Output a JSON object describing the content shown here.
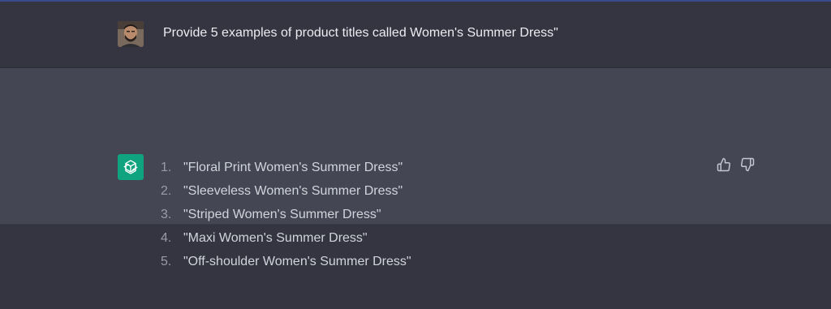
{
  "conversation": {
    "user_message": "Provide 5 examples of product titles called Women's Summer Dress\"",
    "assistant_items": [
      {
        "num": "1.",
        "text": "\"Floral Print Women's Summer Dress\""
      },
      {
        "num": "2.",
        "text": "\"Sleeveless Women's Summer Dress\""
      },
      {
        "num": "3.",
        "text": "\"Striped Women's Summer Dress\""
      },
      {
        "num": "4.",
        "text": "\"Maxi Women's Summer Dress\""
      },
      {
        "num": "5.",
        "text": "\"Off-shoulder Women's Summer Dress\""
      }
    ]
  },
  "icons": {
    "user_avatar": "user-avatar",
    "assistant_avatar": "openai-logo-icon",
    "thumbs_up": "thumbs-up-icon",
    "thumbs_down": "thumbs-down-icon"
  },
  "colors": {
    "background": "#343541",
    "assistant_background": "#444654",
    "assistant_avatar_bg": "#10a37f",
    "text": "#ececf1"
  }
}
